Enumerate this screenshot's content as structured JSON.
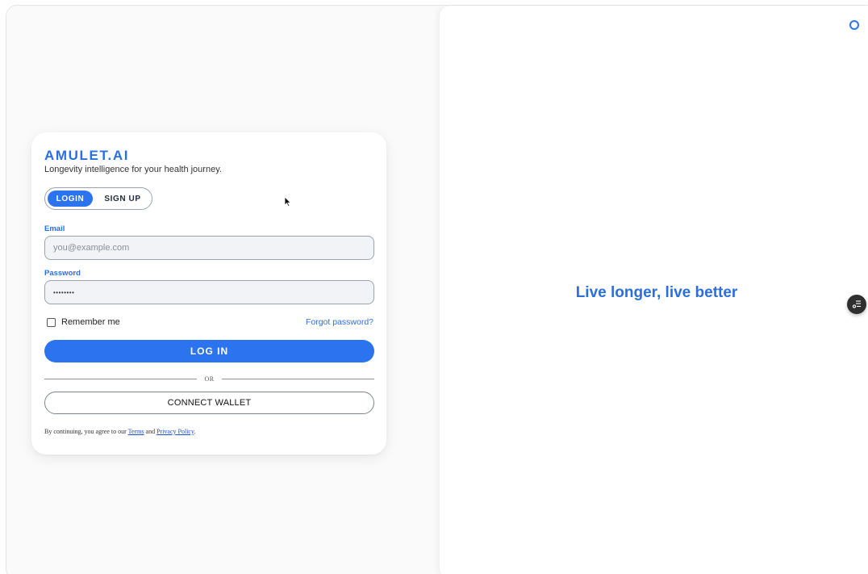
{
  "brand": {
    "name": "AMULET.AI",
    "tagline": "Longevity intelligence for your health journey."
  },
  "auth_toggle": {
    "login_label": "LOGIN",
    "signup_label": "SIGN UP",
    "active": "LOGIN"
  },
  "form": {
    "email": {
      "label": "Email",
      "placeholder": "you@example.com",
      "value": ""
    },
    "password": {
      "label": "Password",
      "value": "••••••••"
    },
    "remember_label": "Remember me",
    "remember_checked": false,
    "forgot_label": "Forgot password?",
    "submit_label": "LOG IN",
    "or_label": "OR",
    "wallet_label": "CONNECT WALLET"
  },
  "legal": {
    "prefix": "By continuing, you agree to our",
    "terms": "Terms",
    "and": "and",
    "privacy": "Privacy Policy",
    "suffix": "."
  },
  "hero": {
    "headline": "Live longer, live better"
  },
  "icons": {
    "top_right": "ring-icon",
    "floating": "list-settings-icon",
    "cursor": "mouse-pointer-icon"
  },
  "colors": {
    "accent": "#2b73ef",
    "brand_text": "#2a6fdb",
    "fab": "#2f2f2f"
  }
}
